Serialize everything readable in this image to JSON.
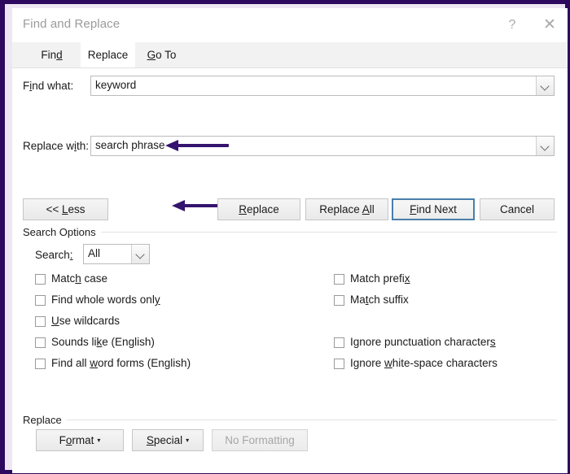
{
  "window": {
    "title": "Find and Replace",
    "help_icon": "question-mark-icon",
    "close_icon": "close-icon"
  },
  "tabs": [
    {
      "label": "Find",
      "accel": "d",
      "active": false
    },
    {
      "label": "Replace",
      "accel": "",
      "active": true
    },
    {
      "label": "Go To",
      "accel": "G",
      "active": false
    }
  ],
  "tab_labels": {
    "find_a": "Fin",
    "find_u": "d",
    "find_b": "",
    "replace": "Replace",
    "goto_a": "",
    "goto_u": "G",
    "goto_b": "o To"
  },
  "fields": {
    "find": {
      "label_a": "F",
      "label_u": "i",
      "label_b": "nd what:",
      "value": "keyword",
      "dropdown_icon": "chevron-down-icon"
    },
    "replace": {
      "label_a": "Replace w",
      "label_u": "i",
      "label_b": "th:",
      "value": "search phrase",
      "dropdown_icon": "chevron-down-icon"
    }
  },
  "buttons": {
    "less": {
      "a": "<< ",
      "u": "L",
      "b": "ess"
    },
    "replace": {
      "a": "",
      "u": "R",
      "b": "eplace"
    },
    "replace_all": {
      "a": "Replace ",
      "u": "A",
      "b": "ll"
    },
    "find_next": {
      "a": "",
      "u": "F",
      "b": "ind Next",
      "focused": true
    },
    "cancel": {
      "a": "Cancel",
      "u": "",
      "b": ""
    }
  },
  "search_options": {
    "group_label": "Search Options",
    "search_label_a": "Search",
    "search_label_u": ":",
    "search_label_b": "",
    "search_value": "All",
    "search_dropdown_icon": "chevron-down-icon",
    "left_checkboxes": [
      {
        "a": "Matc",
        "u": "h",
        "b": " case",
        "checked": false
      },
      {
        "a": "Find whole words onl",
        "u": "y",
        "b": "",
        "checked": false
      },
      {
        "a": "",
        "u": "U",
        "b": "se wildcards",
        "checked": false
      },
      {
        "a": "Sounds li",
        "u": "k",
        "b": "e (English)",
        "checked": false
      },
      {
        "a": "Find all ",
        "u": "w",
        "b": "ord forms (English)",
        "checked": false
      }
    ],
    "right_checkboxes": [
      {
        "a": "Match prefi",
        "u": "x",
        "b": "",
        "checked": false
      },
      {
        "a": "Ma",
        "u": "t",
        "b": "ch suffix",
        "checked": false
      },
      {
        "a": "Ignore punctuation character",
        "u": "s",
        "b": "",
        "checked": false
      },
      {
        "a": "Ignore ",
        "u": "w",
        "b": "hite-space characters",
        "checked": false
      }
    ]
  },
  "replace_group": {
    "group_label": "Replace",
    "format": {
      "a": "F",
      "u": "o",
      "b": "rmat",
      "caret": "▾"
    },
    "special": {
      "a": "",
      "u": "S",
      "b": "pecial",
      "caret": "▾"
    },
    "no_formatting": {
      "a": "No Formatting",
      "u": "",
      "b": ""
    }
  },
  "annotations": [
    {
      "name": "arrow-find-what",
      "direction": "left",
      "color": "#35146e"
    },
    {
      "name": "arrow-replace-with",
      "direction": "left",
      "color": "#35146e"
    }
  ],
  "colors": {
    "frame": "#2d0a5e",
    "accent_arrow": "#35146e",
    "focus_border": "#4a7eab",
    "tab_strip": "#f2f2f2"
  }
}
